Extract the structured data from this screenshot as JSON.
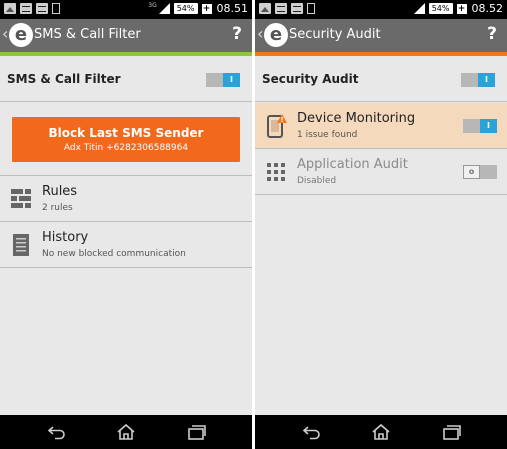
{
  "left": {
    "status_bar": {
      "network": "3G",
      "battery": "54%",
      "time": "08.51"
    },
    "action_bar": {
      "logo": "e",
      "title": "SMS & Call Filter",
      "help": "?"
    },
    "header": {
      "label": "SMS & Call Filter",
      "toggle_state": "I"
    },
    "block_button": {
      "title": "Block Last SMS Sender",
      "subtitle": "Adx Titin +6282306588964"
    },
    "items": [
      {
        "title": "Rules",
        "subtitle": "2 rules",
        "icon": "rules-icon"
      },
      {
        "title": "History",
        "subtitle": "No new blocked communication",
        "icon": "history-icon"
      }
    ],
    "accent_color": "#8cc63f"
  },
  "right": {
    "status_bar": {
      "battery": "54%",
      "time": "08.52"
    },
    "action_bar": {
      "logo": "e",
      "title": "Security Audit",
      "help": "?"
    },
    "header": {
      "label": "Security Audit",
      "toggle_state": "I"
    },
    "items": [
      {
        "title": "Device Monitoring",
        "subtitle": "1 issue found",
        "icon": "device-warning-icon",
        "toggle_state": "I"
      },
      {
        "title": "Application Audit",
        "subtitle": "Disabled",
        "icon": "app-grid-icon",
        "toggle_state": "o"
      }
    ],
    "accent_color": "#f07a1a"
  },
  "colors": {
    "toggle_on": "#2aa3d8",
    "button_orange": "#f2691d",
    "highlight": "#f5d9bd"
  }
}
